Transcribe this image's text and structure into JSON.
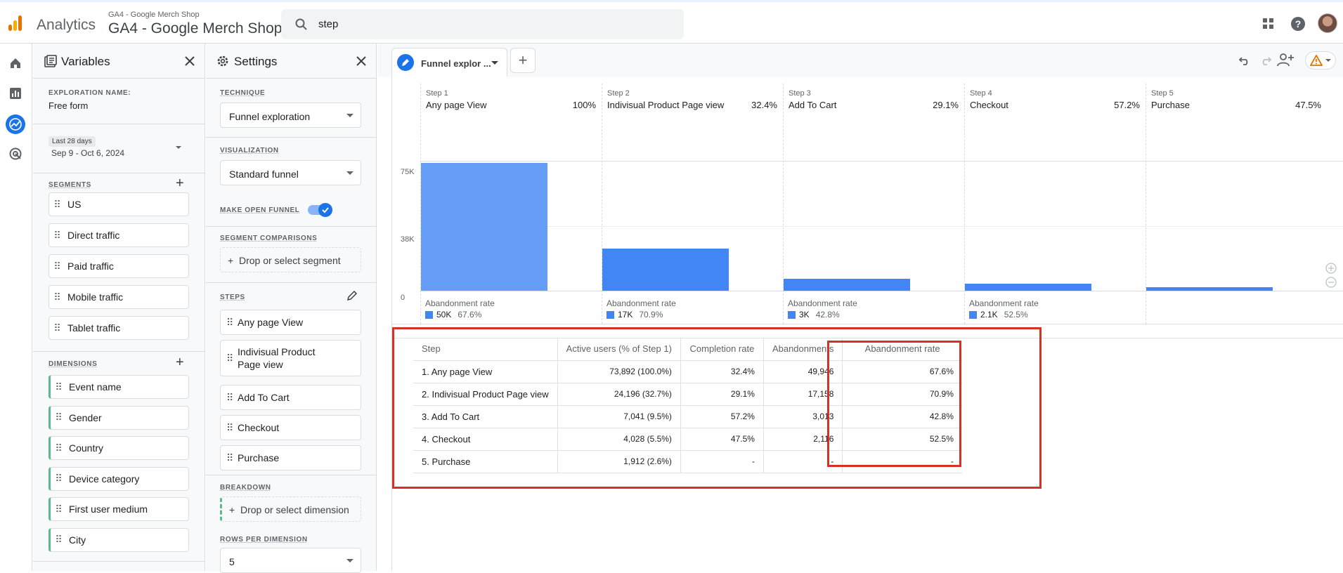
{
  "header": {
    "app_title": "Analytics",
    "account_small": "GA4 - Google Merch Shop",
    "account_big": "GA4 - Google Merch Shop",
    "search_value": "step"
  },
  "variables": {
    "title": "Variables",
    "exploration_label": "EXPLORATION NAME:",
    "exploration_name": "Free form",
    "date_label": "Last 28 days",
    "date_range": "Sep 9 - Oct 6, 2024",
    "segments_label": "SEGMENTS",
    "segments": [
      "US",
      "Direct traffic",
      "Paid traffic",
      "Mobile traffic",
      "Tablet traffic"
    ],
    "dimensions_label": "DIMENSIONS",
    "dimensions": [
      "Event name",
      "Gender",
      "Country",
      "Device category",
      "First user medium",
      "City"
    ]
  },
  "settings": {
    "title": "Settings",
    "technique_label": "TECHNIQUE",
    "technique_value": "Funnel exploration",
    "visualization_label": "VISUALIZATION",
    "visualization_value": "Standard funnel",
    "open_funnel_label": "MAKE OPEN FUNNEL",
    "open_funnel_on": true,
    "segment_comparisons_label": "SEGMENT COMPARISONS",
    "segment_drop": "Drop or select segment",
    "steps_label": "STEPS",
    "steps": [
      "Any page View",
      "Indivisual Product Page view",
      "Add To Cart",
      "Checkout",
      "Purchase"
    ],
    "breakdown_label": "BREAKDOWN",
    "dimension_drop": "Drop or select dimension",
    "rows_label": "ROWS PER DIMENSION",
    "rows_value": "5"
  },
  "tab": {
    "label": "Funnel explor ..."
  },
  "funnel": {
    "yticks": [
      "75K",
      "38K",
      "0"
    ],
    "abandonment_label": "Abandonment rate",
    "steps": [
      {
        "num": "Step 1",
        "name": "Any page View",
        "pct": "100%",
        "abd_count": "50K",
        "abd_rate": "67.6%"
      },
      {
        "num": "Step 2",
        "name": "Indivisual Product Page view",
        "pct": "32.4%",
        "abd_count": "17K",
        "abd_rate": "70.9%"
      },
      {
        "num": "Step 3",
        "name": "Add To Cart",
        "pct": "29.1%",
        "abd_count": "3K",
        "abd_rate": "42.8%"
      },
      {
        "num": "Step 4",
        "name": "Checkout",
        "pct": "57.2%",
        "abd_count": "2.1K",
        "abd_rate": "52.5%"
      },
      {
        "num": "Step 5",
        "name": "Purchase",
        "pct": "47.5%",
        "abd_count": "",
        "abd_rate": ""
      }
    ]
  },
  "chart_data": {
    "type": "bar",
    "categories": [
      "Any page View",
      "Indivisual Product Page view",
      "Add To Cart",
      "Checkout",
      "Purchase"
    ],
    "values": [
      73892,
      24196,
      7041,
      4028,
      1912
    ],
    "ylim": [
      0,
      75000
    ],
    "yticks": [
      "75K",
      "38K",
      "0"
    ],
    "color": "#4285f4",
    "step1_color": "#669df6"
  },
  "table": {
    "headers": [
      "Step",
      "Active users (% of Step 1)",
      "Completion rate",
      "Abandonments",
      "Abandonment rate"
    ],
    "rows": [
      [
        "1. Any page View",
        "73,892 (100.0%)",
        "32.4%",
        "49,946",
        "67.6%"
      ],
      [
        "2. Indivisual Product Page view",
        "24,196 (32.7%)",
        "29.1%",
        "17,158",
        "70.9%"
      ],
      [
        "3. Add To Cart",
        "7,041 (9.5%)",
        "57.2%",
        "3,013",
        "42.8%"
      ],
      [
        "4. Checkout",
        "4,028 (5.5%)",
        "47.5%",
        "2,116",
        "52.5%"
      ],
      [
        "5. Purchase",
        "1,912 (2.6%)",
        "-",
        "-",
        "-"
      ]
    ]
  },
  "colors": {
    "accent": "#1a73e8",
    "bar": "#4285f4",
    "highlight_box": "#d93025",
    "warning": "#e37400"
  }
}
